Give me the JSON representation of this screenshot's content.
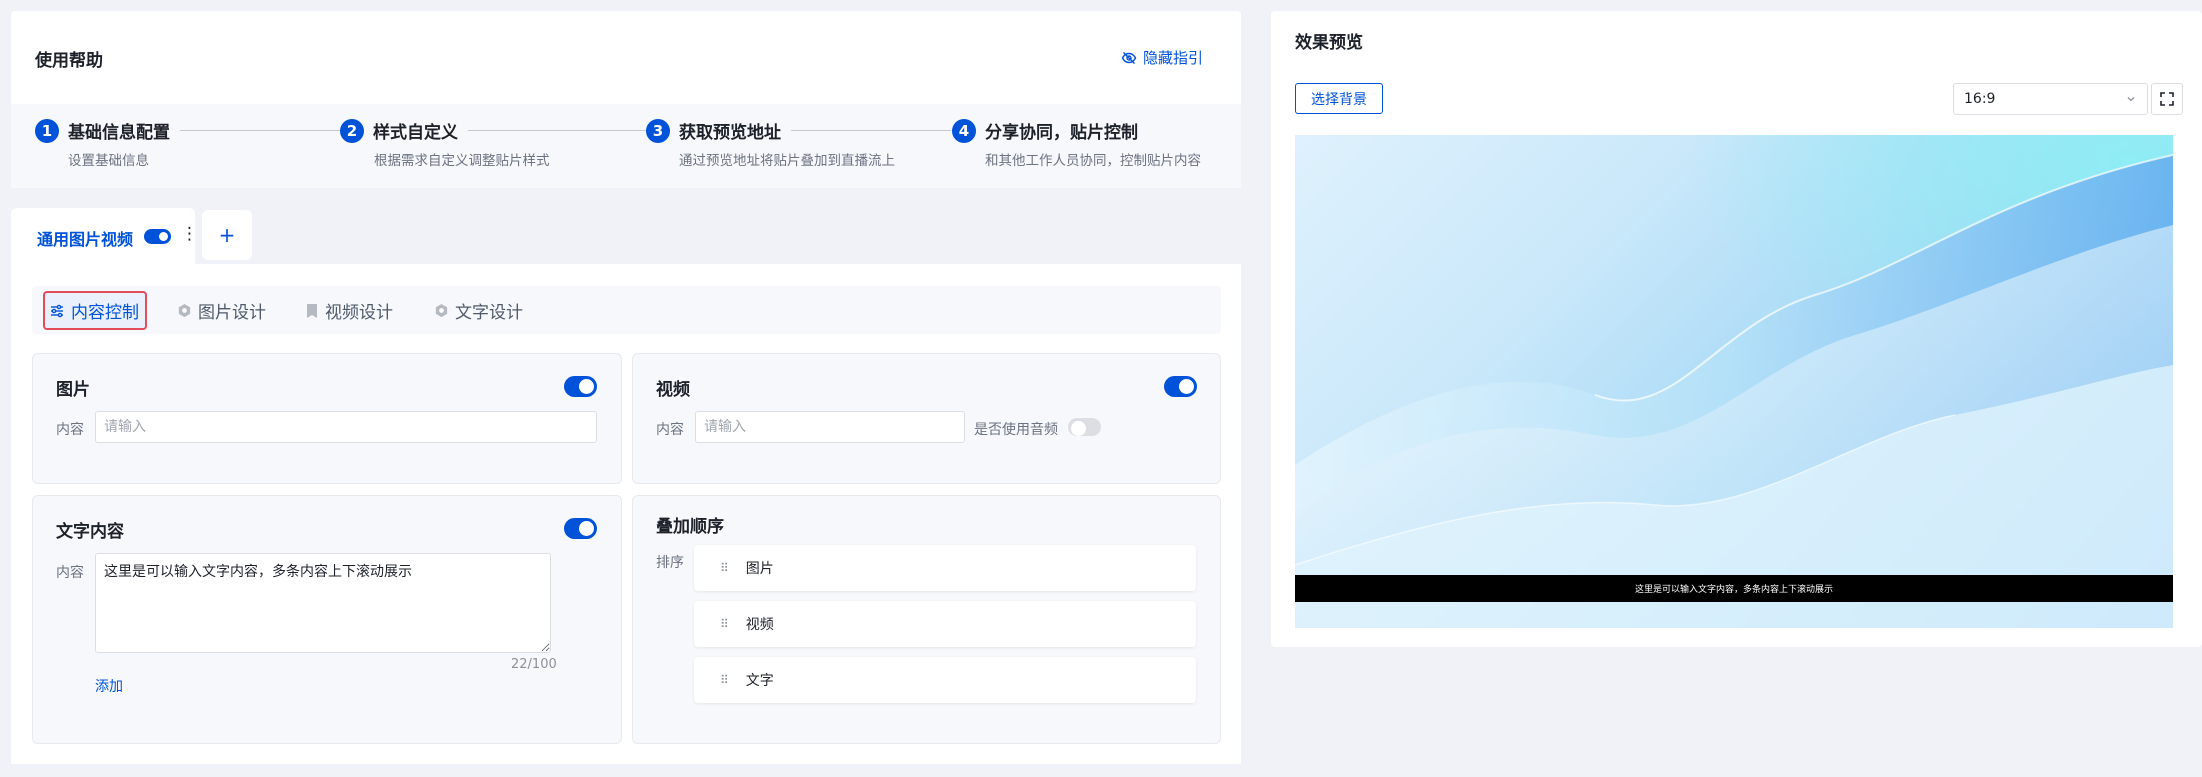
{
  "help": {
    "title": "使用帮助",
    "hide_label": "隐藏指引",
    "steps": [
      {
        "num": "1",
        "title": "基础信息配置",
        "desc": "设置基础信息"
      },
      {
        "num": "2",
        "title": "样式自定义",
        "desc": "根据需求自定义调整贴片样式"
      },
      {
        "num": "3",
        "title": "获取预览地址",
        "desc": "通过预览地址将贴片叠加到直播流上"
      },
      {
        "num": "4",
        "title": "分享协同，贴片控制",
        "desc": "和其他工作人员协同，控制贴片内容"
      }
    ]
  },
  "tabs": {
    "active_label": "通用图片视频",
    "more_glyph": "⋮",
    "add_glyph": "+"
  },
  "subtabs": [
    {
      "label": "内容控制",
      "active": true
    },
    {
      "label": "图片设计",
      "active": false
    },
    {
      "label": "视频设计",
      "active": false
    },
    {
      "label": "文字设计",
      "active": false
    }
  ],
  "image_panel": {
    "title": "图片",
    "enabled": true,
    "content_label": "内容",
    "content_placeholder": "请输入"
  },
  "video_panel": {
    "title": "视频",
    "enabled": true,
    "content_label": "内容",
    "content_placeholder": "请输入",
    "audio_label": "是否使用音频",
    "audio_enabled": false
  },
  "text_panel": {
    "title": "文字内容",
    "enabled": true,
    "content_label": "内容",
    "content_value": "这里是可以输入文字内容，多条内容上下滚动展示",
    "counter": "22/100",
    "add_label": "添加"
  },
  "order_panel": {
    "title": "叠加顺序",
    "sort_label": "排序",
    "items": [
      "图片",
      "视频",
      "文字"
    ]
  },
  "preview": {
    "title": "效果预览",
    "bg_button": "选择背景",
    "ratio": "16:9",
    "subtitle_text": "这里是可以输入文字内容，多条内容上下滚动展示"
  },
  "colors": {
    "primary": "#0052d9",
    "highlight_border": "#e34d59"
  }
}
